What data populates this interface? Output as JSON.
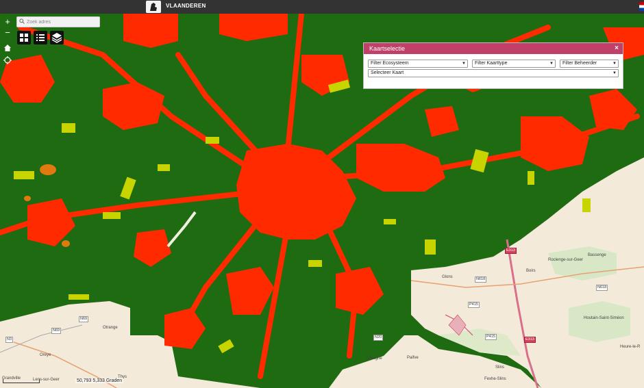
{
  "header": {
    "title": "VLAANDEREN"
  },
  "map_controls": {
    "zoom_in": "+",
    "zoom_out": "−"
  },
  "search": {
    "placeholder": "Zoek adres"
  },
  "panel": {
    "title": "Kaartselectie",
    "close": "×",
    "filter_ecosystem": "Filter Ecosysteem",
    "filter_maptype": "Filter Kaarttype",
    "filter_manager": "Filter Beheerder",
    "select_map": "Selecteer Kaart"
  },
  "places": {
    "glons": "Glons",
    "boirs": "Boirs",
    "roclenge": "Roclenge-sur-Geer",
    "bassenge": "Bassenge",
    "otrange": "Otrange",
    "oreye": "Oreye",
    "grandville": "Grandville",
    "lens": "Lens-sur-Geer",
    "thys": "Thys",
    "wihogne": "Wihogne",
    "paifve": "Paifve",
    "slins": "Slins",
    "fexhe": "Fexhe-Slins",
    "houtain": "Houtain-Saint-Siméon",
    "heure": "Heure-le-R"
  },
  "roads": {
    "e313_a": "E313",
    "e313_b": "E313",
    "n618_a": "N618",
    "n618_b": "N618",
    "n69_a": "N69",
    "n69_b": "N69",
    "n3": "N3",
    "n20": "N20",
    "p415_a": "P415",
    "p415_b": "P415"
  },
  "status": {
    "scale": "50,793",
    "coords": "5,333 Graden"
  },
  "colors": {
    "urban": "#ff2a00",
    "forest": "#1f6b12",
    "grass": "#c8d400",
    "base": "#f3ead9",
    "panel_header": "#c0406a"
  }
}
